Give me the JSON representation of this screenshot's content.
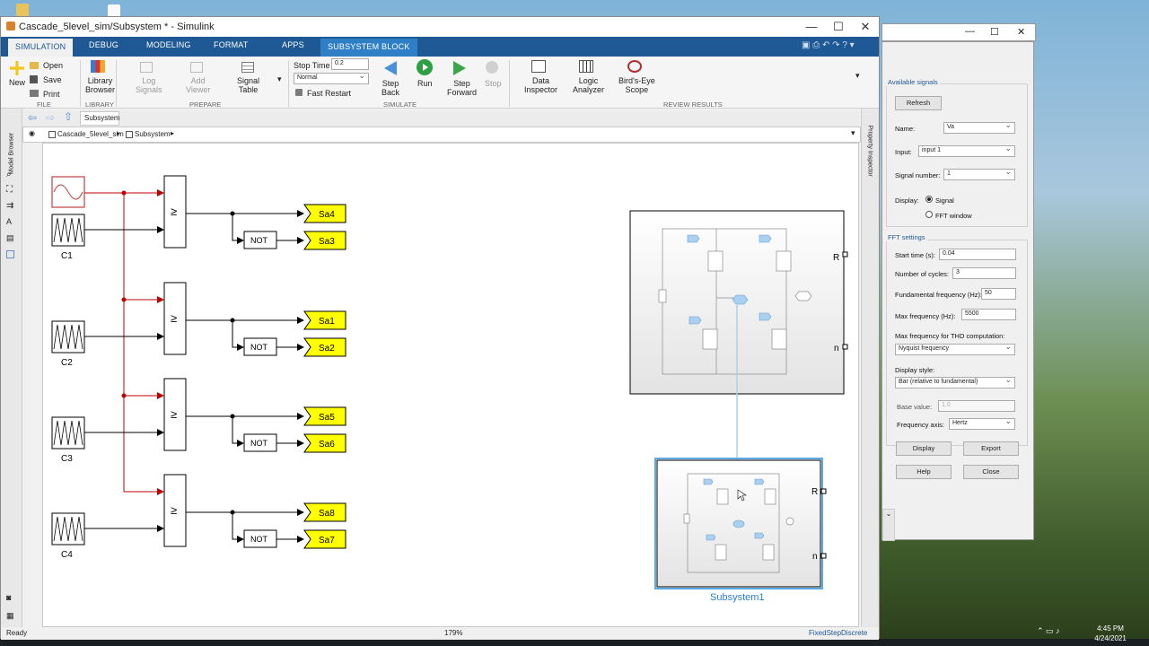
{
  "window": {
    "title": "Cascade_5level_sim/Subsystem * - Simulink",
    "tabs": [
      "SIMULATION",
      "DEBUG",
      "MODELING",
      "FORMAT",
      "APPS",
      "SUBSYSTEM BLOCK"
    ]
  },
  "ribbon": {
    "new": "New",
    "open": "Open",
    "save": "Save",
    "print": "Print",
    "library_browser": [
      "Library",
      "Browser"
    ],
    "log_signals": [
      "Log",
      "Signals"
    ],
    "add_viewer": [
      "Add",
      "Viewer"
    ],
    "signal_table": [
      "Signal",
      "Table"
    ],
    "stop_time_label": "Stop Time",
    "stop_time_value": "0.2",
    "mode_value": "Normal",
    "fast_restart": "Fast Restart",
    "step_back": [
      "Step",
      "Back"
    ],
    "run": "Run",
    "step_forward": [
      "Step",
      "Forward"
    ],
    "stop": "Stop",
    "data_inspector": [
      "Data",
      "Inspector"
    ],
    "logic_analyzer": [
      "Logic",
      "Analyzer"
    ],
    "birds_eye": [
      "Bird's-Eye",
      "Scope"
    ],
    "sections": [
      "FILE",
      "LIBRARY",
      "PREPARE",
      "SIMULATE",
      "REVIEW RESULTS"
    ]
  },
  "breadcrumb": {
    "tab": "Subsystem",
    "path": [
      "Cascade_5level_sim",
      "Subsystem"
    ]
  },
  "side": {
    "left_label": "Model Browser",
    "right_label": "Property Inspector"
  },
  "diagram": {
    "carriers": [
      "C1",
      "C2",
      "C3",
      "C4"
    ],
    "compare_symbol": "≥",
    "not_label": "NOT",
    "gotos": [
      [
        "Sa4",
        "Sa3"
      ],
      [
        "Sa1",
        "Sa2"
      ],
      [
        "Sa5",
        "Sa6"
      ],
      [
        "Sa8",
        "Sa7"
      ]
    ],
    "ports": [
      "R",
      "n"
    ],
    "subsystem1_label": "Subsystem1"
  },
  "status": {
    "left": "Ready",
    "zoom": "179%",
    "solver": "FixedStepDiscrete"
  },
  "fft": {
    "available_signals": "Available signals",
    "refresh": "Refresh",
    "name_label": "Name:",
    "name_value": "Va",
    "input_label": "Input:",
    "input_value": "input 1",
    "signal_number_label": "Signal number:",
    "signal_number_value": "1",
    "display_label": "Display:",
    "display_signal": "Signal",
    "display_fft": "FFT window",
    "fft_settings": "FFT settings",
    "start_time_label": "Start time (s):",
    "start_time_value": "0.04",
    "cycles_label": "Number of cycles:",
    "cycles_value": "3",
    "fund_freq_label": "Fundamental frequency (Hz):",
    "fund_freq_value": "50",
    "max_freq_label": "Max frequency (Hz):",
    "max_freq_value": "5500",
    "thd_label": "Max frequency for THD computation:",
    "thd_value": "Nyquist frequency",
    "style_label": "Display style:",
    "style_value": "Bar (relative to fundamental)",
    "base_label": "Base value:",
    "base_value": "1.0",
    "axis_label": "Frequency axis:",
    "axis_value": "Hertz",
    "display_btn": "Display",
    "export_btn": "Export",
    "help_btn": "Help",
    "close_btn": "Close"
  },
  "tray": {
    "time": "4:45 PM",
    "date": "4/24/2021"
  },
  "colors": {
    "tab_bar": "#1e5895",
    "goto_fill": "#ffff00",
    "link_red": "#c00000",
    "selection": "#5aaae6"
  }
}
